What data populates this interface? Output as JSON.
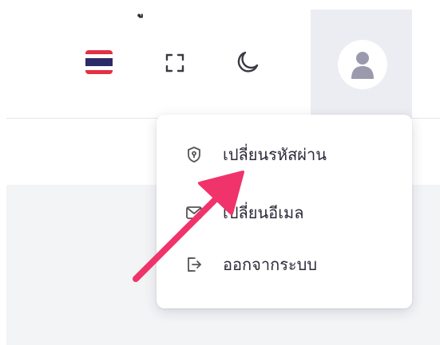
{
  "header": {
    "top_glyph": "ู",
    "icons": {
      "language": "thai-flag-icon",
      "fullscreen": "fullscreen-icon",
      "theme": "moon-icon",
      "profile": "user-avatar-icon"
    }
  },
  "user_menu": {
    "items": [
      {
        "label": "เปลี่ยนรหัสผ่าน",
        "icon": "shield-keyhole-icon"
      },
      {
        "label": "เปลี่ยนอีเมล",
        "icon": "mail-icon"
      },
      {
        "label": "ออกจากระบบ",
        "icon": "logout-icon"
      }
    ]
  },
  "colors": {
    "accent_arrow": "#f0336b",
    "avatar_panel": "#ecedf2",
    "content_bg": "#f3f4f6",
    "menu_text": "#2a2a3a",
    "icon_gray": "#555555"
  }
}
